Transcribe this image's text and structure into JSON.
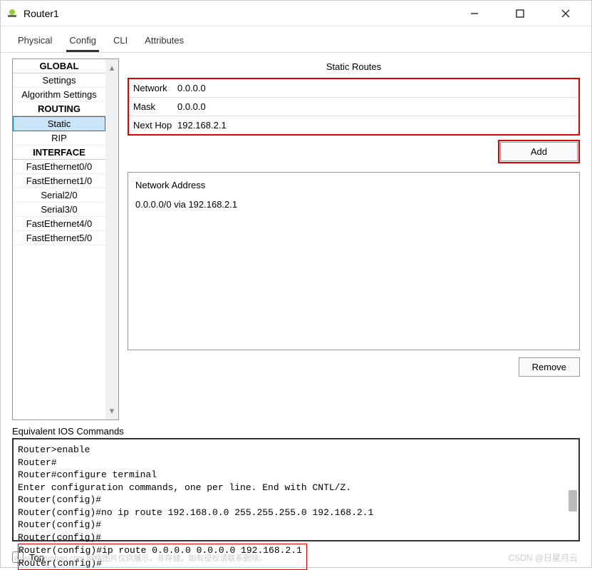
{
  "window": {
    "title": "Router1"
  },
  "tabs": {
    "physical": "Physical",
    "config": "Config",
    "cli": "CLI",
    "attributes": "Attributes"
  },
  "sidebar": {
    "global": "GLOBAL",
    "settings": "Settings",
    "algorithm_settings": "Algorithm Settings",
    "routing": "ROUTING",
    "static": "Static",
    "rip": "RIP",
    "interface": "INTERFACE",
    "fe00": "FastEthernet0/0",
    "fe10": "FastEthernet1/0",
    "se20": "Serial2/0",
    "se30": "Serial3/0",
    "fe40": "FastEthernet4/0",
    "fe50": "FastEthernet5/0"
  },
  "form": {
    "title": "Static Routes",
    "network_label": "Network",
    "network_value": "0.0.0.0",
    "mask_label": "Mask",
    "mask_value": "0.0.0.0",
    "nexthop_label": "Next Hop",
    "nexthop_value": "192.168.2.1",
    "add": "Add",
    "remove": "Remove"
  },
  "routes": {
    "label": "Network Address",
    "entry": "0.0.0.0/0 via 192.168.2.1"
  },
  "ios": {
    "label": "Equivalent IOS Commands",
    "l1": "Router>enable",
    "l2": "Router#",
    "l3": "Router#configure terminal",
    "l4": "Enter configuration commands, one per line.  End with CNTL/Z.",
    "l5": "Router(config)#",
    "l6": "Router(config)#no ip route 192.168.0.0 255.255.255.0 192.168.2.1",
    "l7": "Router(config)#",
    "l8": "Router(config)#",
    "l9": "Router(config)#ip route 0.0.0.0 0.0.0.0 192.168.2.1",
    "l10": "Router(config)#"
  },
  "footer": {
    "top": "Top"
  },
  "watermark": {
    "left": "www.toymoban.com 网络图片仅供展示，非存储，如有侵权请联系删除。",
    "right": "CSDN @日星月云"
  }
}
